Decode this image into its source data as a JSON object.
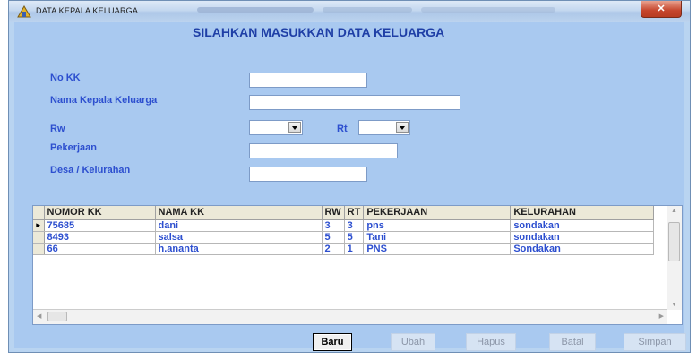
{
  "window": {
    "title": "DATA KEPALA KELUARGA",
    "close_symbol": "✕"
  },
  "heading": "SILAHKAN MASUKKAN DATA KELUARGA",
  "form": {
    "no_kk_label": "No KK",
    "no_kk_value": "",
    "nama_label": "Nama Kepala Keluarga",
    "nama_value": "",
    "rw_label": "Rw",
    "rw_value": "",
    "rt_label": "Rt",
    "rt_value": "",
    "pekerjaan_label": "Pekerjaan",
    "pekerjaan_value": "",
    "desa_label": "Desa / Kelurahan",
    "desa_value": ""
  },
  "grid": {
    "columns": [
      "NOMOR KK",
      "NAMA KK",
      "RW",
      "RT",
      "PEKERJAAN",
      "KELURAHAN"
    ],
    "rows": [
      {
        "indicator": "►",
        "nomor_kk": "75685",
        "nama_kk": "dani",
        "rw": "3",
        "rt": "3",
        "pekerjaan": "pns",
        "kelurahan": "sondakan"
      },
      {
        "indicator": "",
        "nomor_kk": "8493",
        "nama_kk": "salsa",
        "rw": "5",
        "rt": "5",
        "pekerjaan": "Tani",
        "kelurahan": "sondakan"
      },
      {
        "indicator": "",
        "nomor_kk": "66",
        "nama_kk": "h.ananta",
        "rw": "2",
        "rt": "1",
        "pekerjaan": "PNS",
        "kelurahan": "Sondakan"
      }
    ]
  },
  "buttons": {
    "baru": "Baru",
    "ubah": "Ubah",
    "hapus": "Hapus",
    "batal": "Batal",
    "simpan": "Simpan"
  }
}
